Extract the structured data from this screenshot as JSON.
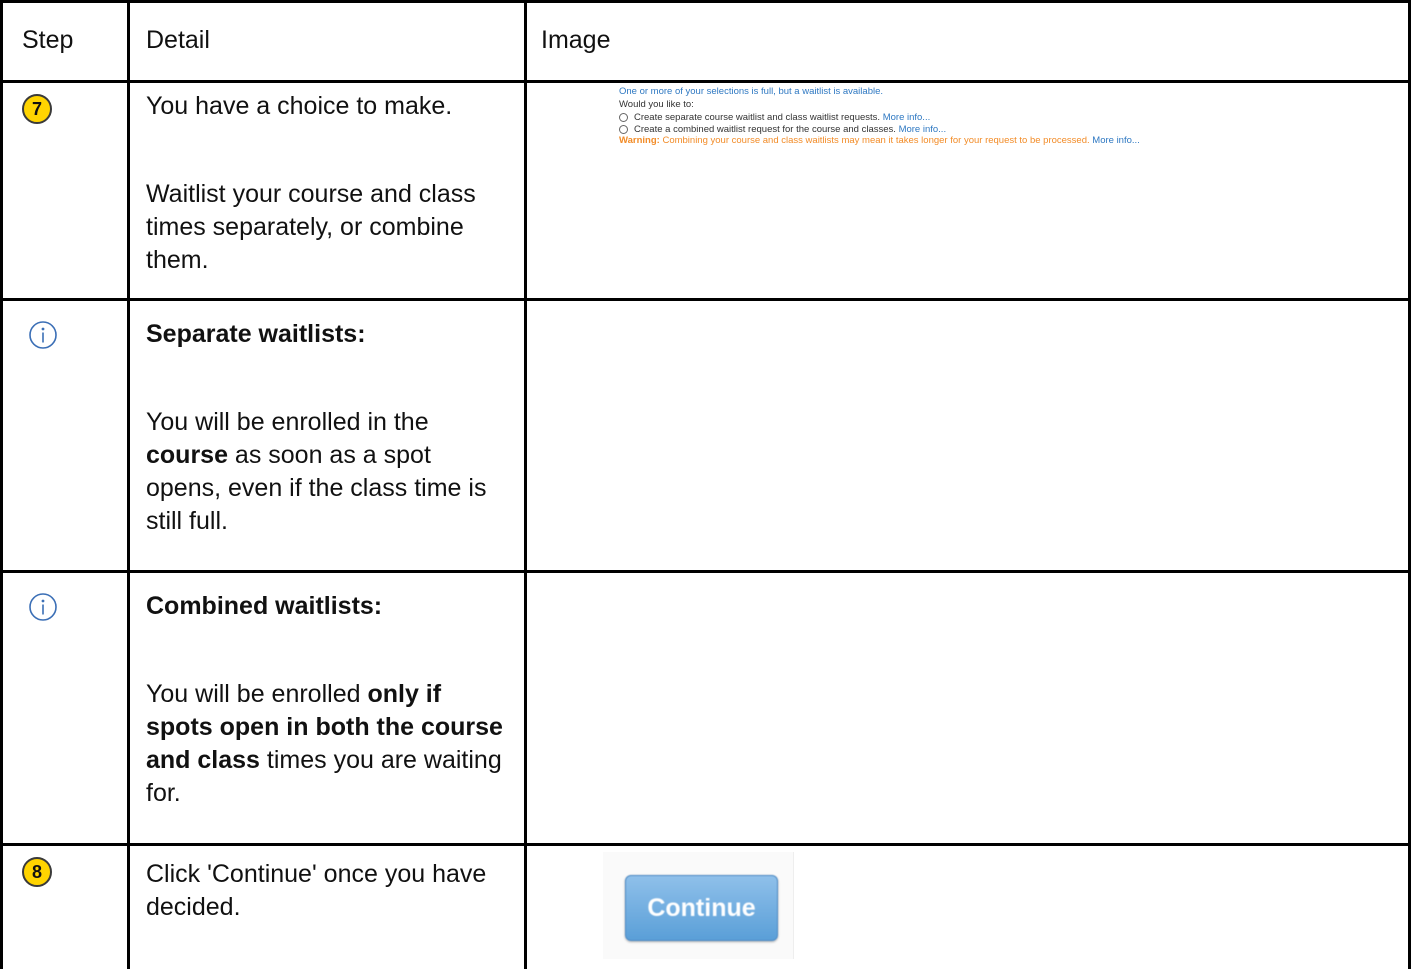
{
  "header": {
    "step": "Step",
    "detail": "Detail",
    "image": "Image"
  },
  "rows": [
    {
      "badge": "7",
      "detail_line1": "You have a choice to make.",
      "detail_line2": "Waitlist your course and class times separately, or combine them.",
      "screenshot": {
        "notice": "One or more of your selections is full, but a waitlist is available.",
        "question": "Would you like to:",
        "option1": "Create separate course waitlist and class waitlist requests.",
        "option2": "Create a combined waitlist request for the course and classes.",
        "more_info": "More info...",
        "warning_label": "Warning:",
        "warning_text": "Combining your course and class waitlists may mean it takes longer for your request to be processed."
      }
    },
    {
      "icon": "info-icon",
      "title": "Separate waitlists:",
      "text_pre": "You will be enrolled in the ",
      "text_bold": "course",
      "text_post": " as soon as a spot opens, even if the class time is still full."
    },
    {
      "icon": "info-icon",
      "title": "Combined waitlists:",
      "text_pre": "You will be enrolled ",
      "text_bold": "only if spots open in both the course and class",
      "text_post": " times you are waiting for."
    },
    {
      "badge": "8",
      "detail": "Click 'Continue' once you have decided.",
      "button_label": "Continue"
    }
  ],
  "colors": {
    "badge": "#ffd400",
    "info_icon": "#3b6fb6",
    "link": "#2e78c2",
    "warning": "#f28c28"
  }
}
